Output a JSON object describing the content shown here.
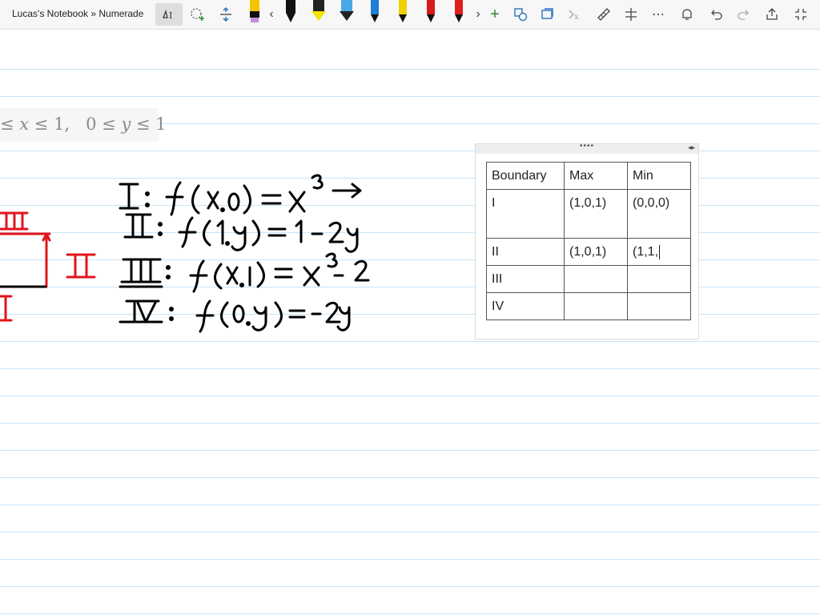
{
  "app": {
    "notebook_title": "Lucas's Notebook » Numerade"
  },
  "toolbar": {
    "tools": [
      "lasso-select-icon",
      "shape-add-icon",
      "insert-space-icon"
    ],
    "pens": [
      {
        "name": "black-pen",
        "color": "#1a1a1a",
        "cap": "#c58be0"
      },
      {
        "name": "black-marker",
        "color": "#111111"
      },
      {
        "name": "yellow-highlighter",
        "color": "#f5e400"
      },
      {
        "name": "blue-highlighter",
        "color": "#4aa8e8"
      },
      {
        "name": "black-pen-2",
        "color": "#1a1a1a"
      },
      {
        "name": "blue-pen",
        "color": "#1e7fd4"
      },
      {
        "name": "yellow-pen",
        "color": "#f0d000"
      },
      {
        "name": "red-pen",
        "color": "#d61b1b"
      },
      {
        "name": "red-pen-2",
        "color": "#e11e1e"
      }
    ],
    "right_tools": [
      "shapes-icon",
      "convert-icon",
      "math-icon",
      "ruler-icon",
      "adjust-icon",
      "more-icon",
      "bell-icon",
      "undo-icon",
      "redo-icon",
      "share-icon",
      "fullscreen-icon"
    ]
  },
  "math_header": {
    "text_a": "≤ ",
    "x": "x",
    "text_b": " ≤ 1,",
    "text_c": "0 ≤ ",
    "y": "y",
    "text_d": " ≤ 1"
  },
  "table": {
    "headers": [
      "Boundary",
      "Max",
      "Min"
    ],
    "rows": [
      [
        "I",
        "(1,0,1)",
        "(0,0,0)"
      ],
      [
        "II",
        "(1,0,1)",
        "(1,1,"
      ],
      [
        "III",
        "",
        ""
      ],
      [
        "IV",
        "",
        ""
      ]
    ]
  },
  "colors": {
    "ink_black": "#000000",
    "ink_red": "#e2141c",
    "rule_line": "#c9e4f7"
  }
}
